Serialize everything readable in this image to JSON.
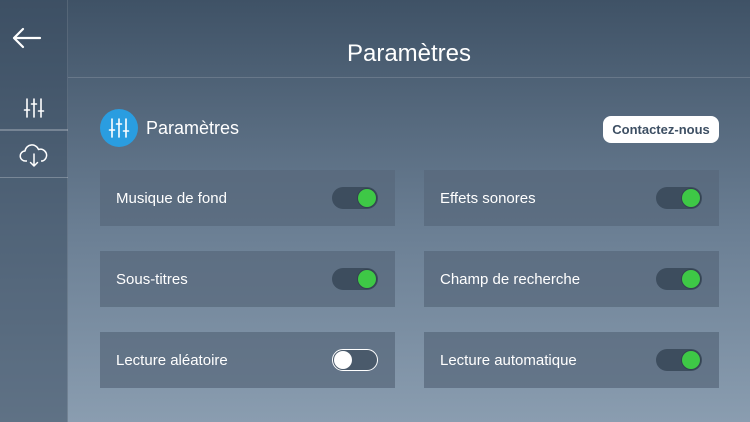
{
  "header": {
    "title": "Paramètres"
  },
  "section": {
    "title": "Paramètres",
    "contact_label": "Contactez-nous"
  },
  "sidebar": {
    "back_icon": "arrow-left-icon",
    "items": [
      {
        "icon": "sliders-icon",
        "name": "settings"
      },
      {
        "icon": "cloud-download-icon",
        "name": "download"
      }
    ]
  },
  "settings": [
    {
      "label": "Musique de fond",
      "on": true
    },
    {
      "label": "Effets sonores",
      "on": true
    },
    {
      "label": "Sous-titres",
      "on": true
    },
    {
      "label": "Champ de recherche",
      "on": true
    },
    {
      "label": "Lecture aléatoire",
      "on": false
    },
    {
      "label": "Lecture automatique",
      "on": true
    }
  ],
  "colors": {
    "accent": "#2a9de0",
    "toggle_on": "#3ec846"
  }
}
